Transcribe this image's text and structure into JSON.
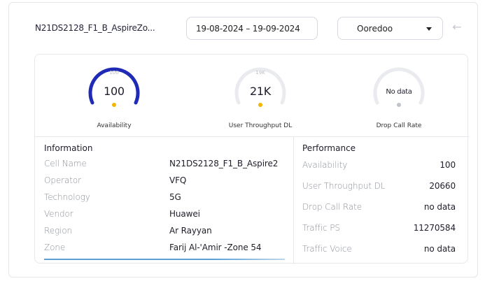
{
  "toolbar": {
    "cell_name": "N21DS2128_F1_B_AspireZo...",
    "date_range": "19-08-2024 – 19-09-2024",
    "operator": "Ooredoo",
    "back_icon": "arrow-left-icon"
  },
  "gauges": [
    {
      "label": "Availability",
      "value": "100",
      "max": "100",
      "fill_fraction": 1.0,
      "color": "#1f2bb4",
      "dot_color": "#f2b600"
    },
    {
      "label": "User Throughput DL",
      "value": "21K",
      "max": "19K",
      "fill_fraction": 0.0,
      "color": "#e9ebef",
      "dot_color": "#f2b600"
    },
    {
      "label": "Drop Call Rate",
      "value": "No data",
      "max": "",
      "fill_fraction": 0.0,
      "color": "#e9ebef",
      "dot_color": "#bfc3ca"
    }
  ],
  "information": {
    "title": "Information",
    "rows": [
      {
        "label": "Cell Name",
        "value": "N21DS2128_F1_B_Aspire2"
      },
      {
        "label": "Operator",
        "value": "VFQ"
      },
      {
        "label": "Technology",
        "value": "5G"
      },
      {
        "label": "Vendor",
        "value": "Huawei"
      },
      {
        "label": "Region",
        "value": "Ar Rayyan"
      },
      {
        "label": "Zone",
        "value": "Farij Al-'Amir -Zone 54"
      }
    ]
  },
  "performance": {
    "title": "Performance",
    "rows": [
      {
        "label": "Availability",
        "value": "100"
      },
      {
        "label": "User Throughput DL",
        "value": "20660"
      },
      {
        "label": "Drop Call Rate",
        "value": "no data"
      },
      {
        "label": "Traffic PS",
        "value": "11270584"
      },
      {
        "label": "Traffic Voice",
        "value": "no data"
      }
    ]
  }
}
